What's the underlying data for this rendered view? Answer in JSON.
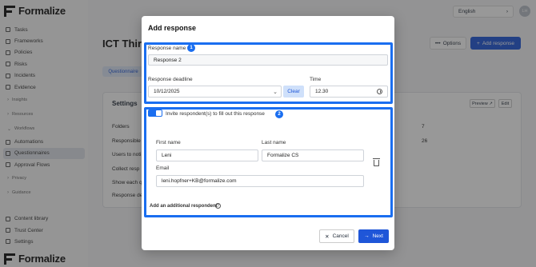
{
  "app": {
    "brand": "Formalize",
    "nav": [
      {
        "label": "Tasks",
        "icon": "check-square-icon"
      },
      {
        "label": "Frameworks",
        "icon": "framework-icon"
      },
      {
        "label": "Policies",
        "icon": "shield-icon"
      },
      {
        "label": "Risks",
        "icon": "warning-icon"
      },
      {
        "label": "Incidents",
        "icon": "incident-icon"
      },
      {
        "label": "Evidence",
        "icon": "folder-icon"
      }
    ],
    "groups": [
      "Insights",
      "Resources",
      "Workflows"
    ],
    "workflow_items": [
      {
        "label": "Automations",
        "icon": "automation-icon"
      },
      {
        "label": "Questionnaires",
        "icon": "questionnaire-icon",
        "active": true
      },
      {
        "label": "Approval Flows",
        "icon": "approval-icon"
      }
    ],
    "groups2": [
      "Privacy",
      "Guidance"
    ],
    "bottom_nav": [
      {
        "label": "Content library",
        "icon": "library-icon"
      },
      {
        "label": "Trust Center",
        "icon": "trust-icon"
      },
      {
        "label": "Settings",
        "icon": "gear-icon"
      }
    ],
    "language": "English",
    "avatar_initials": "LH",
    "page_title": "ICT Third",
    "options_label": "Options",
    "add_response_label": "Add response",
    "tab_label": "Questionnaire",
    "settings": {
      "title": "Settings",
      "preview_label": "Preview",
      "edit_label": "Edit",
      "rows": [
        {
          "label": "Folders",
          "value": "7"
        },
        {
          "label": "Responsible o",
          "value": "26"
        },
        {
          "label": "Users to noti",
          "value": ""
        },
        {
          "label": "Collect resp",
          "value": ""
        },
        {
          "label": "Show each qu",
          "value": ""
        },
        {
          "label": "Response de",
          "value": ""
        }
      ]
    }
  },
  "modal": {
    "title": "Add response",
    "badge1": "1",
    "badge2": "2",
    "response_name_label": "Response name",
    "response_name_value": "Response 2",
    "deadline_label": "Response deadline",
    "deadline_value": "10/12/2025",
    "clear_label": "Clear",
    "time_label": "Time",
    "time_value": "12.30",
    "invite_label": "Invite respondent(s) to fill out this response",
    "invite_enabled": true,
    "first_name_label": "First name",
    "first_name_value": "Leni",
    "last_name_label": "Last name",
    "last_name_value": "Formalize CS",
    "email_label": "Email",
    "email_value": "leni.hopfner+KB@formalize.com",
    "add_respondent_label": "Add an additional respondent",
    "cancel_label": "Cancel",
    "next_label": "Next"
  },
  "colors": {
    "accent": "#1f56d8",
    "highlight": "#1a6ef0",
    "overlay": "rgba(40,40,40,0.48)"
  }
}
